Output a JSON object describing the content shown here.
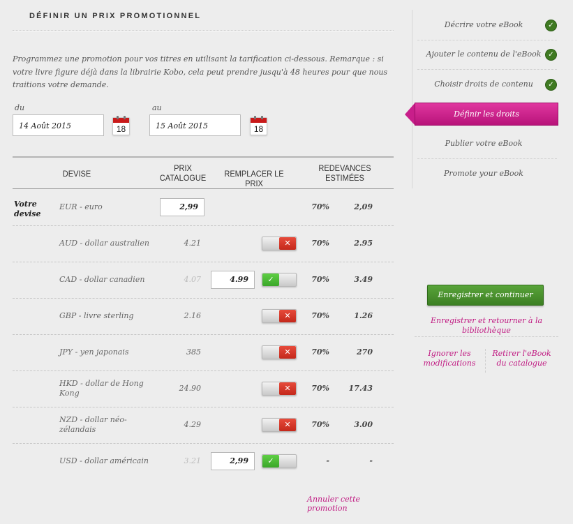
{
  "section_title": "DÉFINIR UN PRIX PROMOTIONNEL",
  "intro_text": "Programmez une promotion pour vos titres en utilisant la tarification ci-dessous. Remarque : si votre livre figure déjà dans la librairie Kobo, cela peut prendre jusqu'à 48 heures pour que nous traitions votre demande.",
  "dates": {
    "from_label": "du",
    "from_value": "14 Août 2015",
    "to_label": "au",
    "to_value": "15 Août 2015",
    "calendar_day": "18"
  },
  "table": {
    "headers": {
      "currency": "DEVISE",
      "list_price": "PRIX CATALOGUE",
      "replace_price": "REMPLACER LE PRIX",
      "royalties": "REDEVANCES ESTIMÉES"
    },
    "your_currency_label": "Votre devise",
    "rows": [
      {
        "currency": "EUR - euro",
        "list_price": "2,99",
        "replace": "",
        "toggle": "none",
        "percent": "70%",
        "royalty": "2,09"
      },
      {
        "currency": "AUD - dollar australien",
        "list_price": "4.21",
        "replace": "",
        "toggle": "off",
        "percent": "70%",
        "royalty": "2.95"
      },
      {
        "currency": "CAD - dollar canadien",
        "list_price": "4.07",
        "replace": "4.99",
        "toggle": "on",
        "percent": "70%",
        "royalty": "3.49"
      },
      {
        "currency": "GBP - livre sterling",
        "list_price": "2.16",
        "replace": "",
        "toggle": "off",
        "percent": "70%",
        "royalty": "1.26"
      },
      {
        "currency": "JPY - yen japonais",
        "list_price": "385",
        "replace": "",
        "toggle": "off",
        "percent": "70%",
        "royalty": "270"
      },
      {
        "currency": "HKD - dollar de Hong Kong",
        "list_price": "24.90",
        "replace": "",
        "toggle": "off",
        "percent": "70%",
        "royalty": "17.43"
      },
      {
        "currency": "NZD - dollar néo-zélandais",
        "list_price": "4.29",
        "replace": "",
        "toggle": "off",
        "percent": "70%",
        "royalty": "3.00"
      },
      {
        "currency": "USD - dollar américain",
        "list_price": "3.21",
        "replace": "2,99",
        "toggle": "on",
        "percent": "-",
        "royalty": "-"
      }
    ],
    "toggle_off_glyph": "✕",
    "toggle_on_glyph": "✓"
  },
  "cancel_promotion": "Annuler cette promotion",
  "sidebar": {
    "steps": [
      {
        "label": "Décrire votre eBook",
        "done": true
      },
      {
        "label": "Ajouter le contenu de l'eBook",
        "done": true
      },
      {
        "label": "Choisir droits de contenu",
        "done": true
      },
      {
        "label": "Définir les droits",
        "active": true
      },
      {
        "label": "Publier votre eBook"
      },
      {
        "label": "Promote your eBook"
      }
    ],
    "check_glyph": "✓",
    "save_continue": "Enregistrer et continuer",
    "save_return": "Enregistrer et retourner à la bibliothèque",
    "ignore_changes": "Ignorer les modifications",
    "remove_ebook": "Retirer l'eBook du catalogue"
  },
  "colors": {
    "accent_pink": "#c01a82",
    "save_green": "#3c7f23",
    "toggle_off_red": "#c4281b",
    "toggle_on_green": "#3aa629"
  }
}
